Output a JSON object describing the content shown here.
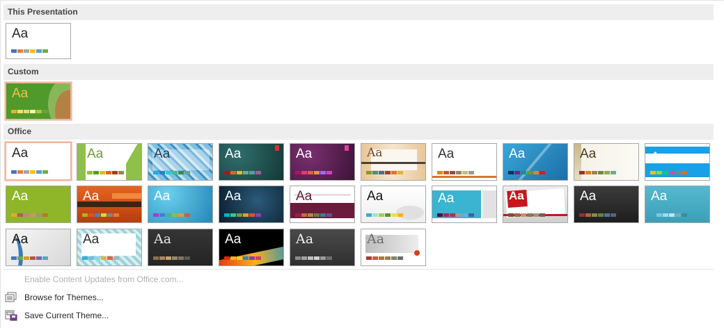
{
  "sections": {
    "this_presentation": "This Presentation",
    "custom": "Custom",
    "office": "Office"
  },
  "theme_label": "Aa",
  "colors": {
    "header_bg": "#eeeeee",
    "selected_border": "#f3b49b",
    "disabled_text": "#b0b0b0"
  },
  "menu": {
    "enable_updates": "Enable Content Updates from Office.com...",
    "browse": "Browse for Themes...",
    "save": "Save Current Theme..."
  },
  "icons": {
    "browse": "browse-themes-icon",
    "save": "save-theme-icon"
  }
}
